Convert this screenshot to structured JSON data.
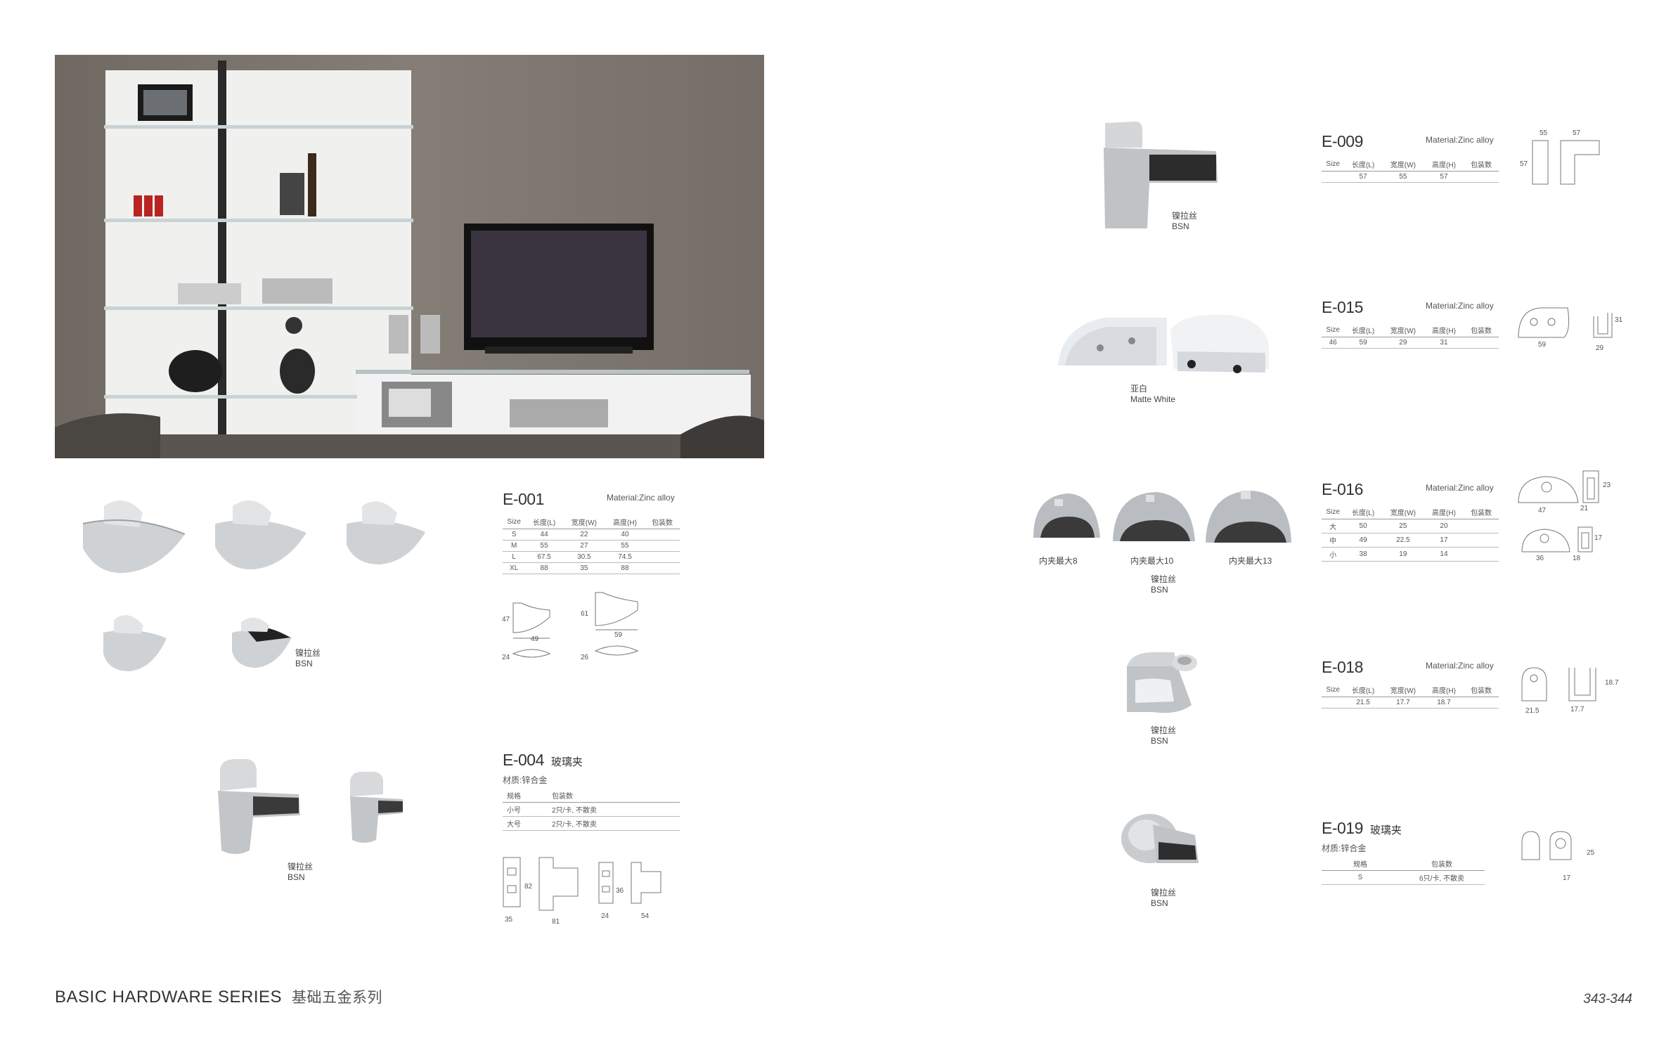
{
  "footer": {
    "title": "BASIC HARDWARE SERIES",
    "title_cn": "基础五金系列",
    "page": "343-344"
  },
  "products": {
    "e001": {
      "code": "E-001",
      "material": "Material:Zinc alloy",
      "headers": [
        "Size",
        "长度(L)",
        "宽度(W)",
        "高度(H)",
        "包装数"
      ],
      "rows": [
        [
          "S",
          "44",
          "22",
          "40",
          ""
        ],
        [
          "M",
          "55",
          "27",
          "55",
          ""
        ],
        [
          "L",
          "67.5",
          "30.5",
          "74.5",
          ""
        ],
        [
          "XL",
          "88",
          "35",
          "88",
          ""
        ]
      ],
      "dims": [
        "47",
        "49",
        "24",
        "61",
        "59",
        "26"
      ],
      "finish_cn": "镍拉丝",
      "finish": "BSN"
    },
    "e004": {
      "code": "E-004",
      "name_cn": "玻璃夹",
      "material": "材质:锌合金",
      "headers": [
        "规格",
        "包装数"
      ],
      "rows": [
        [
          "小号",
          "2只/卡, 不散卖"
        ],
        [
          "大号",
          "2只/卡, 不散卖"
        ]
      ],
      "dims": [
        "82",
        "35",
        "81",
        "36",
        "24",
        "54"
      ],
      "finish_cn": "镍拉丝",
      "finish": "BSN"
    },
    "e009": {
      "code": "E-009",
      "material": "Material:Zinc alloy",
      "headers": [
        "Size",
        "长度(L)",
        "宽度(W)",
        "高度(H)",
        "包装数"
      ],
      "rows": [
        [
          "",
          "57",
          "55",
          "57",
          ""
        ]
      ],
      "dims": [
        "55",
        "57",
        "57"
      ],
      "finish_cn": "镍拉丝",
      "finish": "BSN"
    },
    "e015": {
      "code": "E-015",
      "material": "Material:Zinc alloy",
      "headers": [
        "Size",
        "长度(L)",
        "宽度(W)",
        "高度(H)",
        "包装数"
      ],
      "rows": [
        [
          "46",
          "59",
          "29",
          "31",
          ""
        ]
      ],
      "dims": [
        "59",
        "31",
        "29"
      ],
      "finish_cn": "亚白",
      "finish": "Matte White"
    },
    "e016": {
      "code": "E-016",
      "material": "Material:Zinc alloy",
      "headers": [
        "Size",
        "长度(L)",
        "宽度(W)",
        "高度(H)",
        "包装数"
      ],
      "rows": [
        [
          "大",
          "50",
          "25",
          "20",
          ""
        ],
        [
          "中",
          "49",
          "22.5",
          "17",
          ""
        ],
        [
          "小",
          "38",
          "19",
          "14",
          ""
        ]
      ],
      "dims": [
        "47",
        "23",
        "21",
        "36",
        "17",
        "18"
      ],
      "clip_labels": [
        "内夹最大8",
        "内夹最大10",
        "内夹最大13"
      ],
      "finish_cn": "镍拉丝",
      "finish": "BSN"
    },
    "e018": {
      "code": "E-018",
      "material": "Material:Zinc alloy",
      "headers": [
        "Size",
        "长度(L)",
        "宽度(W)",
        "高度(H)",
        "包装数"
      ],
      "rows": [
        [
          "",
          "21.5",
          "17.7",
          "18.7",
          ""
        ]
      ],
      "dims": [
        "21.5",
        "18.7",
        "17.7"
      ],
      "finish_cn": "镍拉丝",
      "finish": "BSN"
    },
    "e019": {
      "code": "E-019",
      "name_cn": "玻璃夹",
      "material": "材质:锌合金",
      "headers": [
        "规格",
        "包装数"
      ],
      "rows": [
        [
          "S",
          "6只/卡, 不散卖"
        ]
      ],
      "dims": [
        "25",
        "17"
      ],
      "finish_cn": "镍拉丝",
      "finish": "BSN"
    }
  }
}
